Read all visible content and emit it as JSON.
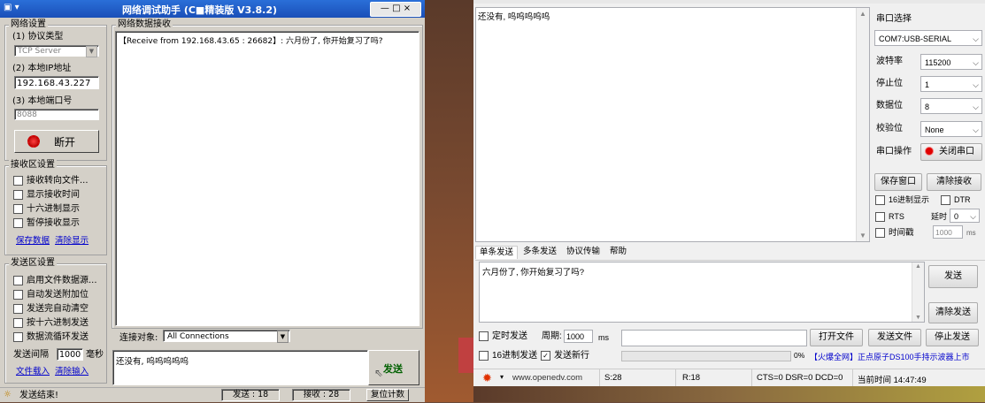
{
  "left": {
    "title": "网络调试助手 (C■精装版 V3.8.2)",
    "network": {
      "group": "网络设置",
      "protocol_label": "(1) 协议类型",
      "protocol_value": "TCP Server",
      "ip_label": "(2) 本地IP地址",
      "ip_value": "192.168.43.227",
      "port_label": "(3) 本地端口号",
      "port_value": "8088",
      "disconnect": "断开"
    },
    "recv": {
      "group": "接收区设置",
      "opts": [
        "接收转向文件...",
        "显示接收时间",
        "十六进制显示",
        "暂停接收显示"
      ],
      "save": "保存数据",
      "clear": "清除显示"
    },
    "send": {
      "group": "发送区设置",
      "opts": [
        "启用文件数据源...",
        "自动发送附加位",
        "发送完自动清空",
        "按十六进制发送",
        "数据流循环发送"
      ],
      "interval_label": "发送间隔",
      "interval_value": "1000",
      "interval_unit": "毫秒",
      "file_load": "文件载入",
      "clear_input": "清除输入"
    },
    "data_group": "网络数据接收",
    "received": "【Receive from 192.168.43.65 : 26682】: 六月份了, 你开始复习了吗?",
    "target_label": "连接对象:",
    "target_value": "All Connections",
    "send_text": "还没有, 呜呜呜呜呜",
    "send_button": "发送",
    "status_text": "发送结束!",
    "sent_count": "发送 : 18",
    "recv_count": "接收 : 28",
    "reset": "复位计数"
  },
  "right": {
    "recv_text": "还没有, 呜呜呜呜呜",
    "port_select_label": "串口选择",
    "port_value": "COM7:USB-SERIAL",
    "baud_label": "波特率",
    "baud_value": "115200",
    "stop_label": "停止位",
    "stop_value": "1",
    "data_label": "数据位",
    "data_value": "8",
    "parity_label": "校验位",
    "parity_value": "None",
    "op_label": "串口操作",
    "close_port": "关闭串口",
    "save_window": "保存窗口",
    "clear_recv": "清除接收",
    "hex_display": "16进制显示",
    "dtr": "DTR",
    "rts": "RTS",
    "delay_label": "延时",
    "delay_value": "0",
    "timestamp": "时间戳",
    "timestamp_value": "1000",
    "ms": "ms",
    "tabs": [
      "单条发送",
      "多条发送",
      "协议传输",
      "帮助"
    ],
    "send_text": "六月份了, 你开始复习了吗?",
    "send_button": "发送",
    "clear_send": "清除发送",
    "timed_send": "定时发送",
    "period_label": "周期:",
    "period_value": "1000",
    "open_file": "打开文件",
    "send_file": "发送文件",
    "stop_send": "停止发送",
    "hex_send": "16进制发送",
    "send_newline": "发送新行",
    "percent": "0%",
    "ad": "【火爆全网】正点原子DS100手持示波器上市",
    "url": "www.openedv.com",
    "s_count": "S:28",
    "r_count": "R:18",
    "signals": "CTS=0 DSR=0 DCD=0",
    "time": "当前时间 14:47:49"
  }
}
